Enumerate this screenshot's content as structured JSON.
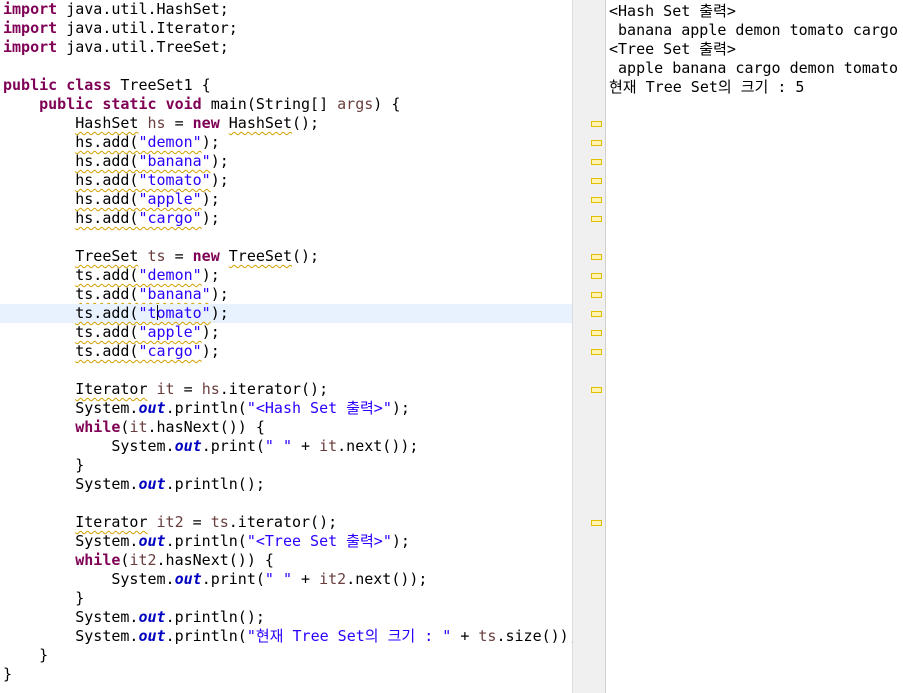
{
  "editor": {
    "lines": [
      [
        {
          "t": "import",
          "c": "kw"
        },
        {
          "t": " java.util.HashSet;"
        }
      ],
      [
        {
          "t": "import",
          "c": "kw"
        },
        {
          "t": " java.util.Iterator;"
        }
      ],
      [
        {
          "t": "import",
          "c": "kw"
        },
        {
          "t": " java.util.TreeSet;"
        }
      ],
      [],
      [
        {
          "t": "public",
          "c": "kw"
        },
        {
          "t": " "
        },
        {
          "t": "class",
          "c": "kw"
        },
        {
          "t": " TreeSet1 {"
        }
      ],
      [
        {
          "t": "    "
        },
        {
          "t": "public",
          "c": "kw"
        },
        {
          "t": " "
        },
        {
          "t": "static",
          "c": "kw"
        },
        {
          "t": " "
        },
        {
          "t": "void",
          "c": "kw"
        },
        {
          "t": " main(String[] "
        },
        {
          "t": "args",
          "c": "loc"
        },
        {
          "t": ") {"
        }
      ],
      [
        {
          "t": "        "
        },
        {
          "t": "HashSet",
          "c": "warn"
        },
        {
          "t": " "
        },
        {
          "t": "hs",
          "c": "loc"
        },
        {
          "t": " = "
        },
        {
          "t": "new",
          "c": "kw"
        },
        {
          "t": " "
        },
        {
          "t": "HashSet",
          "c": "warn"
        },
        {
          "t": "();"
        }
      ],
      [
        {
          "t": "        "
        },
        {
          "t": "hs.add(",
          "c": "warn"
        },
        {
          "t": "\"demon\"",
          "c": "str warn"
        },
        {
          "t": ");"
        }
      ],
      [
        {
          "t": "        "
        },
        {
          "t": "hs.add(",
          "c": "warn"
        },
        {
          "t": "\"banana\"",
          "c": "str warn"
        },
        {
          "t": ");"
        }
      ],
      [
        {
          "t": "        "
        },
        {
          "t": "hs.add(",
          "c": "warn"
        },
        {
          "t": "\"tomato\"",
          "c": "str warn"
        },
        {
          "t": ");"
        }
      ],
      [
        {
          "t": "        "
        },
        {
          "t": "hs.add(",
          "c": "warn"
        },
        {
          "t": "\"apple\"",
          "c": "str warn"
        },
        {
          "t": ");"
        }
      ],
      [
        {
          "t": "        "
        },
        {
          "t": "hs.add(",
          "c": "warn"
        },
        {
          "t": "\"cargo\"",
          "c": "str warn"
        },
        {
          "t": ");"
        }
      ],
      [],
      [
        {
          "t": "        "
        },
        {
          "t": "TreeSet",
          "c": "warn"
        },
        {
          "t": " "
        },
        {
          "t": "ts",
          "c": "loc"
        },
        {
          "t": " = "
        },
        {
          "t": "new",
          "c": "kw"
        },
        {
          "t": " "
        },
        {
          "t": "TreeSet",
          "c": "warn"
        },
        {
          "t": "();"
        }
      ],
      [
        {
          "t": "        "
        },
        {
          "t": "ts.add(",
          "c": "warn"
        },
        {
          "t": "\"demon\"",
          "c": "str warn"
        },
        {
          "t": ");"
        }
      ],
      [
        {
          "t": "        "
        },
        {
          "t": "ts.add(",
          "c": "warn"
        },
        {
          "t": "\"banana\"",
          "c": "str warn"
        },
        {
          "t": ");"
        }
      ],
      [
        {
          "t": "        "
        },
        {
          "t": "ts.add(",
          "c": "warn"
        },
        {
          "t": "\"t",
          "c": "str warn"
        },
        {
          "caret": true
        },
        {
          "t": "omato\"",
          "c": "str warn"
        },
        {
          "t": ");"
        }
      ],
      [
        {
          "t": "        "
        },
        {
          "t": "ts.add(",
          "c": "warn"
        },
        {
          "t": "\"apple\"",
          "c": "str warn"
        },
        {
          "t": ");"
        }
      ],
      [
        {
          "t": "        "
        },
        {
          "t": "ts.add(",
          "c": "warn"
        },
        {
          "t": "\"cargo\"",
          "c": "str warn"
        },
        {
          "t": ");"
        }
      ],
      [],
      [
        {
          "t": "        "
        },
        {
          "t": "Iterator",
          "c": "warn"
        },
        {
          "t": " "
        },
        {
          "t": "it",
          "c": "loc"
        },
        {
          "t": " = "
        },
        {
          "t": "hs",
          "c": "loc"
        },
        {
          "t": ".iterator();"
        }
      ],
      [
        {
          "t": "        System."
        },
        {
          "t": "out",
          "c": "fld"
        },
        {
          "t": ".println("
        },
        {
          "t": "\"<Hash Set 출력>\"",
          "c": "str"
        },
        {
          "t": ");"
        }
      ],
      [
        {
          "t": "        "
        },
        {
          "t": "while",
          "c": "kw"
        },
        {
          "t": "("
        },
        {
          "t": "it",
          "c": "loc"
        },
        {
          "t": ".hasNext()) {"
        }
      ],
      [
        {
          "t": "            System."
        },
        {
          "t": "out",
          "c": "fld"
        },
        {
          "t": ".print("
        },
        {
          "t": "\" \"",
          "c": "str"
        },
        {
          "t": " + "
        },
        {
          "t": "it",
          "c": "loc"
        },
        {
          "t": ".next());"
        }
      ],
      [
        {
          "t": "        }"
        }
      ],
      [
        {
          "t": "        System."
        },
        {
          "t": "out",
          "c": "fld"
        },
        {
          "t": ".println();"
        }
      ],
      [],
      [
        {
          "t": "        "
        },
        {
          "t": "Iterator",
          "c": "warn"
        },
        {
          "t": " "
        },
        {
          "t": "it2",
          "c": "loc"
        },
        {
          "t": " = "
        },
        {
          "t": "ts",
          "c": "loc"
        },
        {
          "t": ".iterator();"
        }
      ],
      [
        {
          "t": "        System."
        },
        {
          "t": "out",
          "c": "fld"
        },
        {
          "t": ".println("
        },
        {
          "t": "\"<Tree Set 출력>\"",
          "c": "str"
        },
        {
          "t": ");"
        }
      ],
      [
        {
          "t": "        "
        },
        {
          "t": "while",
          "c": "kw"
        },
        {
          "t": "("
        },
        {
          "t": "it2",
          "c": "loc"
        },
        {
          "t": ".hasNext()) {"
        }
      ],
      [
        {
          "t": "            System."
        },
        {
          "t": "out",
          "c": "fld"
        },
        {
          "t": ".print("
        },
        {
          "t": "\" \"",
          "c": "str"
        },
        {
          "t": " + "
        },
        {
          "t": "it2",
          "c": "loc"
        },
        {
          "t": ".next());"
        }
      ],
      [
        {
          "t": "        }"
        }
      ],
      [
        {
          "t": "        System."
        },
        {
          "t": "out",
          "c": "fld"
        },
        {
          "t": ".println();"
        }
      ],
      [
        {
          "t": "        System."
        },
        {
          "t": "out",
          "c": "fld"
        },
        {
          "t": ".println("
        },
        {
          "t": "\"현재 Tree Set의 크기 : \"",
          "c": "str"
        },
        {
          "t": " + "
        },
        {
          "t": "ts",
          "c": "loc"
        },
        {
          "t": ".size());"
        }
      ],
      [
        {
          "t": "    }"
        }
      ],
      [
        {
          "t": "}"
        }
      ]
    ]
  },
  "console": {
    "lines": [
      "<Hash Set 출력>",
      " banana apple demon tomato cargo",
      "<Tree Set 출력>",
      " apple banana cargo demon tomato",
      "현재 Tree Set의 크기 : 5"
    ]
  },
  "colors": {
    "keyword": "#7f0055",
    "string": "#2a00ff",
    "static_field": "#0000c0",
    "local_variable": "#6a3e3e",
    "warning_marker": "#e0c000",
    "current_line": "#e8f2fe"
  },
  "icons": {
    "overview_marker": "warning-marker-icon",
    "text_caret": "text-cursor-icon"
  }
}
